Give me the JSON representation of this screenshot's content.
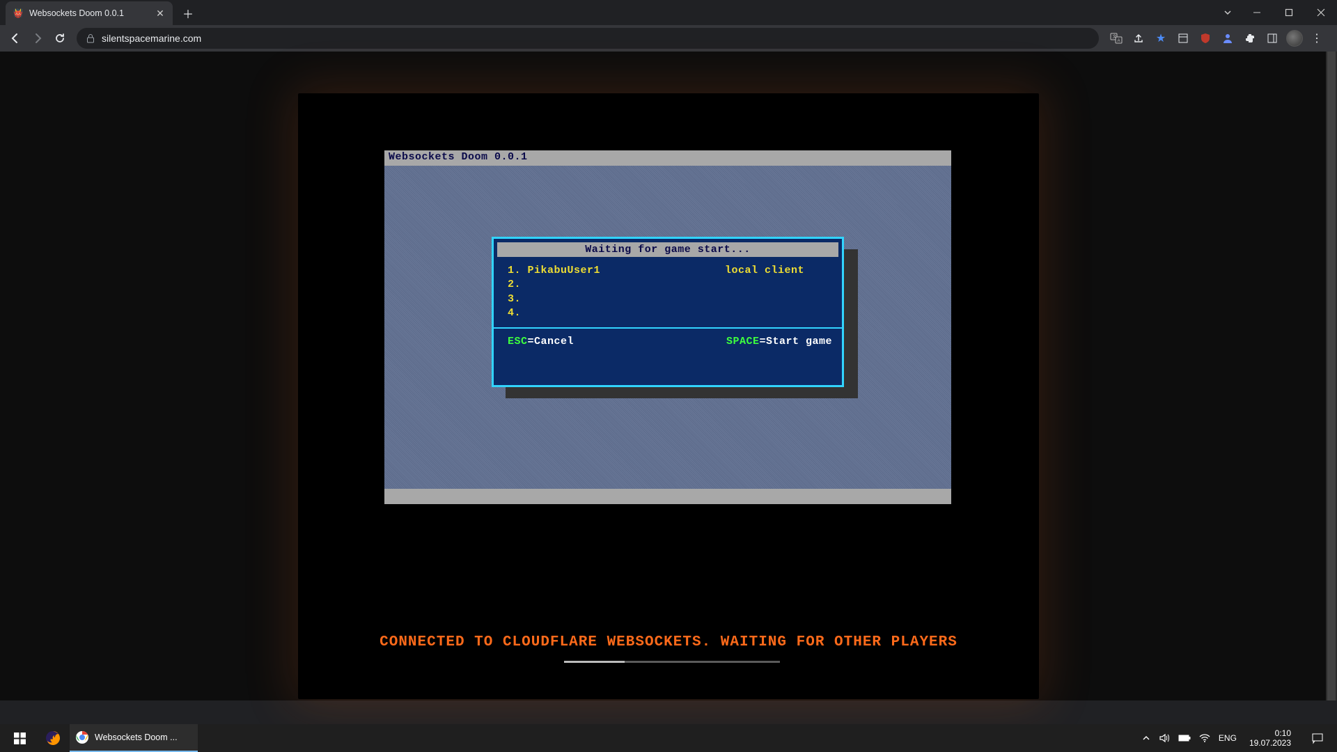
{
  "browser": {
    "tab_title": "Websockets Doom 0.0.1",
    "url": "silentspacemarine.com"
  },
  "game": {
    "window_title": "Websockets Doom 0.0.1",
    "dialog_title": "Waiting for game start...",
    "players": [
      {
        "slot": "1.",
        "name": "PikabuUser1",
        "role": "local client"
      },
      {
        "slot": "2.",
        "name": "",
        "role": ""
      },
      {
        "slot": "3.",
        "name": "",
        "role": ""
      },
      {
        "slot": "4.",
        "name": "",
        "role": ""
      }
    ],
    "footer_left_key": "ESC",
    "footer_left_action": "=Cancel",
    "footer_right_key": "SPACE",
    "footer_right_action": "=Start game",
    "status_message": "CONNECTED TO CLOUDFLARE WEBSOCKETS. WAITING FOR OTHER PLAYERS"
  },
  "taskbar": {
    "app_label": "Websockets Doom ...",
    "lang": "ENG",
    "time": "0:10",
    "date": "19.07.2023"
  }
}
